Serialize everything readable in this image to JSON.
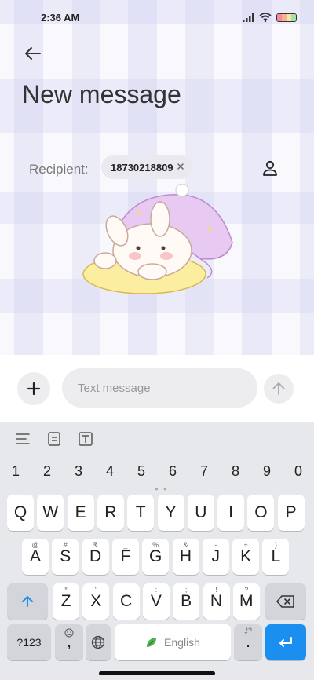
{
  "status": {
    "time": "2:36 AM"
  },
  "header": {
    "title": "New message"
  },
  "recipient": {
    "label": "Recipient:",
    "chip": "18730218809"
  },
  "compose": {
    "placeholder": "Text message"
  },
  "keyboard": {
    "numbers": [
      "1",
      "2",
      "3",
      "4",
      "5",
      "6",
      "7",
      "8",
      "9",
      "0"
    ],
    "row1": [
      "Q",
      "W",
      "E",
      "R",
      "T",
      "Y",
      "U",
      "I",
      "O",
      "P"
    ],
    "row2": [
      {
        "k": "A",
        "s": "@"
      },
      {
        "k": "S",
        "s": "#"
      },
      {
        "k": "D",
        "s": "₹"
      },
      {
        "k": "F",
        "s": "_"
      },
      {
        "k": "G",
        "s": "%"
      },
      {
        "k": "H",
        "s": "&"
      },
      {
        "k": "J",
        "s": "-"
      },
      {
        "k": "K",
        "s": "+"
      },
      {
        "k": "L",
        "s": ")"
      }
    ],
    "row3": [
      {
        "k": "Z",
        "s": "*"
      },
      {
        "k": "X",
        "s": "\""
      },
      {
        "k": "C",
        "s": "'"
      },
      {
        "k": "V",
        "s": ":"
      },
      {
        "k": "B",
        "s": ";"
      },
      {
        "k": "N",
        "s": "!"
      },
      {
        "k": "M",
        "s": "?"
      }
    ],
    "symbols_key": "?123",
    "comma_key": ",",
    "space_label": "English",
    "period_key": ".",
    "period_sup": ",!?"
  }
}
